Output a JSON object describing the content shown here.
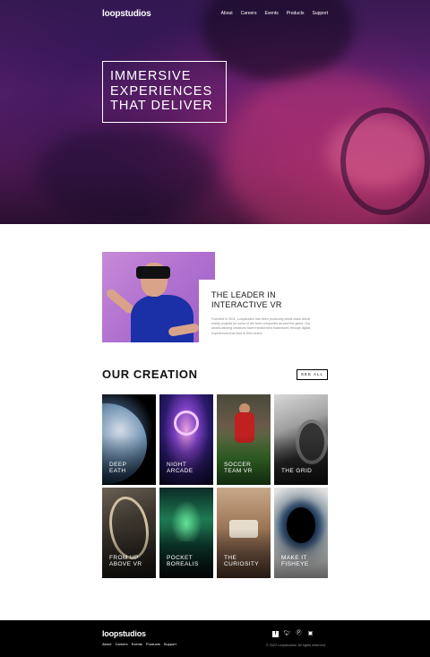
{
  "brand": {
    "logo": "loopstudios"
  },
  "nav": {
    "links": [
      "About",
      "Careers",
      "Events",
      "Products",
      "Support"
    ]
  },
  "hero": {
    "lines": [
      "IMMERSIVE",
      "EXPERIENCES",
      "THAT DELIVER"
    ]
  },
  "interactive": {
    "title_line1": "THE LEADER IN",
    "title_line2": "INTERACTIVE VR",
    "text": "Founded in 2011, Loopstudios has been producing world-class virtual reality projects for some of the best companies around the globe. Our award-winning creations have transformed businesses through digital experiences that bind to their brand."
  },
  "creation": {
    "title": "OUR CREATION",
    "see_all": "SEE ALL",
    "items": [
      {
        "line1": "DEEP",
        "line2": "EATH"
      },
      {
        "line1": "NIGHT",
        "line2": "ARCADE"
      },
      {
        "line1": "SOCCER",
        "line2": "TEAM VR"
      },
      {
        "line1": "",
        "line2": "THE GRID"
      },
      {
        "line1": "FROM UP",
        "line2": "ABOVE VR"
      },
      {
        "line1": "POCKET",
        "line2": "BOREALIS"
      },
      {
        "line1": "THE",
        "line2": "CURIOSITY"
      },
      {
        "line1": "MAKE IT",
        "line2": "FISHEYE"
      }
    ]
  },
  "footer": {
    "logo": "loopstudios",
    "links": [
      "About",
      "Careers",
      "Events",
      "Products",
      "Support"
    ],
    "social": [
      "facebook-icon",
      "twitter-icon",
      "pinterest-icon",
      "instagram-icon"
    ],
    "copyright": "© 2022 Loopstudios. All rights reserved."
  }
}
